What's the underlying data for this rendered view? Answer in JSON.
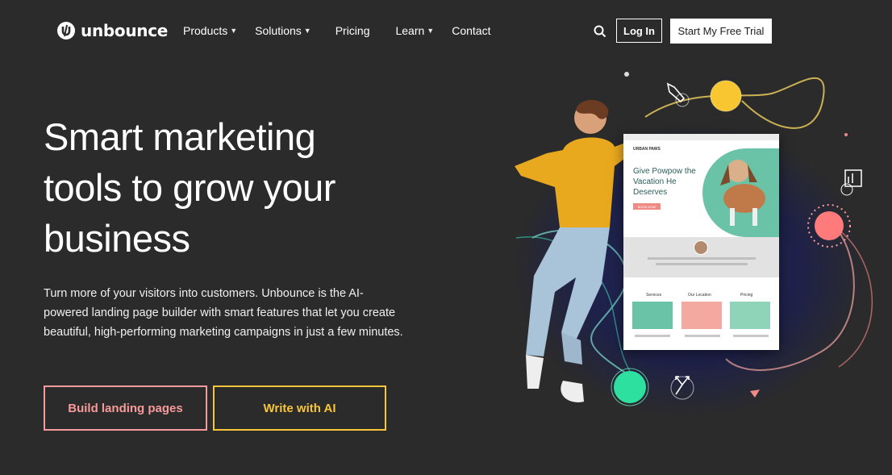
{
  "nav": {
    "logo_text": "unbounce",
    "items": [
      {
        "label": "Products",
        "has_dropdown": true
      },
      {
        "label": "Solutions",
        "has_dropdown": true
      },
      {
        "label": "Pricing",
        "has_dropdown": false
      },
      {
        "label": "Learn",
        "has_dropdown": true
      },
      {
        "label": "Contact",
        "has_dropdown": false
      }
    ],
    "search_icon": "search-icon",
    "login_label": "Log In",
    "trial_label": "Start My Free Trial"
  },
  "hero": {
    "headline": "Smart marketing tools to grow your business",
    "subtext": "Turn more of your visitors into customers. Unbounce is the AI-powered landing page builder with smart features that let you create beautiful, high-performing marketing campaigns in just a few minutes.",
    "cta_primary": "Build landing pages",
    "cta_secondary": "Write with AI"
  },
  "preview_card": {
    "brand": "URBAN PAWS",
    "title": "Give Powpow the Vacation He Deserves",
    "button": "BOOK NOW",
    "sections": [
      "Services",
      "Our Location",
      "Pricing"
    ]
  },
  "colors": {
    "background": "#2b2b2b",
    "cta_primary": "#f79a9a",
    "cta_secondary": "#f7c43a",
    "card_title": "#2b5f5a",
    "card_teal": "#6ac3a6"
  }
}
